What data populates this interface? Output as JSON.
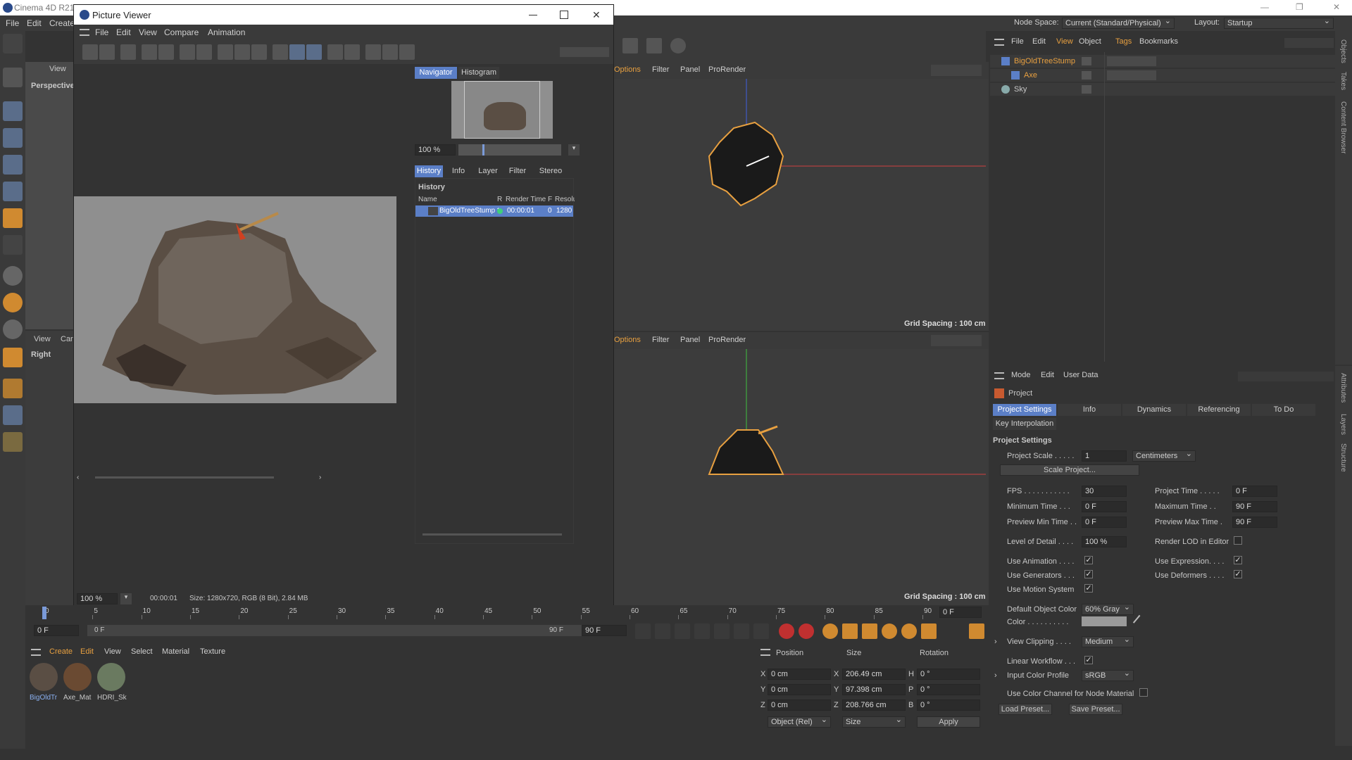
{
  "app": {
    "title": "Cinema 4D R21",
    "win_min": "—",
    "win_max": "❐",
    "win_close": "✕"
  },
  "main_menu": [
    "File",
    "Edit",
    "Create"
  ],
  "node_space": {
    "label": "Node Space:",
    "value": "Current (Standard/Physical)"
  },
  "layout": {
    "label": "Layout:",
    "value": "Startup"
  },
  "picture_viewer": {
    "title": "Picture Viewer",
    "menu": [
      "File",
      "Edit",
      "View",
      "Compare",
      "Animation"
    ],
    "nav_tabs": [
      "Navigator",
      "Histogram"
    ],
    "zoom": "100 %",
    "info_tabs": [
      "History",
      "Info",
      "Layer",
      "Filter",
      "Stereo"
    ],
    "history_title": "History",
    "columns": [
      "Name",
      "R",
      "Render Time",
      "F",
      "Resolu"
    ],
    "row": {
      "name": "BigOldTreeStump *",
      "time": "00:00:01",
      "f": "0",
      "res": "1280"
    },
    "status_zoom": "100 %",
    "status_time": "00:00:01",
    "status_size": "Size: 1280x720, RGB (8 Bit), 2.84 MB"
  },
  "left_view": {
    "menu": "View",
    "perspective": "Perspective",
    "menu2": [
      "View",
      "Car"
    ],
    "right": "Right"
  },
  "viewport_menu": [
    "Options",
    "Filter",
    "Panel",
    "ProRender"
  ],
  "grid_spacing": "Grid Spacing : 100 cm",
  "objects": {
    "menu": [
      "File",
      "Edit",
      "View",
      "Object",
      "Tags",
      "Bookmarks"
    ],
    "items": [
      {
        "name": "BigOldTreeStump",
        "color": "#e8a040"
      },
      {
        "name": "Axe",
        "color": "#e8a040"
      },
      {
        "name": "Sky",
        "color": "#c8c8c8"
      }
    ],
    "side_tabs": [
      "Objects",
      "Takes",
      "Content Browser"
    ]
  },
  "attributes": {
    "menu": [
      "Mode",
      "Edit",
      "User Data"
    ],
    "object": "Project",
    "tabs": [
      "Project Settings",
      "Info",
      "Dynamics",
      "Referencing",
      "To Do"
    ],
    "tab2": "Key Interpolation",
    "section": "Project Settings",
    "project_scale": {
      "label": "Project Scale . . . . .",
      "value": "1",
      "unit": "Centimeters"
    },
    "scale_btn": "Scale Project...",
    "fps": {
      "label": "FPS . . . . . . . . . . .",
      "value": "30"
    },
    "project_time": {
      "label": "Project Time . . . . .",
      "value": "0 F"
    },
    "min_time": {
      "label": "Minimum Time . . .",
      "value": "0 F"
    },
    "max_time": {
      "label": "Maximum Time . .",
      "value": "90 F"
    },
    "prev_min": {
      "label": "Preview Min Time . .",
      "value": "0 F"
    },
    "prev_max": {
      "label": "Preview Max Time .",
      "value": "90 F"
    },
    "lod": {
      "label": "Level of Detail . . . .",
      "value": "100 %"
    },
    "render_lod": "Render LOD in Editor",
    "use_anim": "Use Animation . . . .",
    "use_expr": "Use Expression. . . .",
    "use_gen": "Use Generators . . .",
    "use_def": "Use Deformers . . . .",
    "use_motion": "Use Motion System",
    "def_color": {
      "label": "Default Object Color",
      "value": "60% Gray"
    },
    "color": "Color . . . . . . . . . .",
    "view_clip": {
      "label": "View Clipping . . . .",
      "value": "Medium"
    },
    "linear": "Linear Workflow . . .",
    "input_profile": {
      "label": "Input Color Profile",
      "value": "sRGB"
    },
    "color_channel": "Use Color Channel for Node Material",
    "load": "Load Preset...",
    "save": "Save Preset...",
    "side_tabs": [
      "Attributes",
      "Layers",
      "Structure"
    ]
  },
  "timeline": {
    "ticks": [
      "0",
      "5",
      "10",
      "15",
      "20",
      "25",
      "30",
      "35",
      "40",
      "45",
      "50",
      "55",
      "60",
      "65",
      "70",
      "75",
      "80",
      "85",
      "90"
    ],
    "end_field": "0 F",
    "start": "0 F",
    "cur": "0 F",
    "end": "90 F",
    "end2": "90 F"
  },
  "materials": {
    "menu": [
      "Create",
      "Edit",
      "View",
      "Select",
      "Material",
      "Texture"
    ],
    "items": [
      "BigOldTr",
      "Axe_Mat",
      "HDRI_Sk"
    ]
  },
  "coords": {
    "headers": [
      "Position",
      "Size",
      "Rotation"
    ],
    "rows": [
      {
        "a": "X",
        "p": "0 cm",
        "b": "X",
        "s": "206.49 cm",
        "c": "H",
        "r": "0 °"
      },
      {
        "a": "Y",
        "p": "0 cm",
        "b": "Y",
        "s": "97.398 cm",
        "c": "P",
        "r": "0 °"
      },
      {
        "a": "Z",
        "p": "0 cm",
        "b": "Z",
        "s": "208.766 cm",
        "c": "B",
        "r": "0 °"
      }
    ],
    "mode": "Object (Rel)",
    "size_mode": "Size",
    "apply": "Apply"
  },
  "colors": {
    "accent": "#5b7fc7",
    "orange": "#e8a040"
  }
}
